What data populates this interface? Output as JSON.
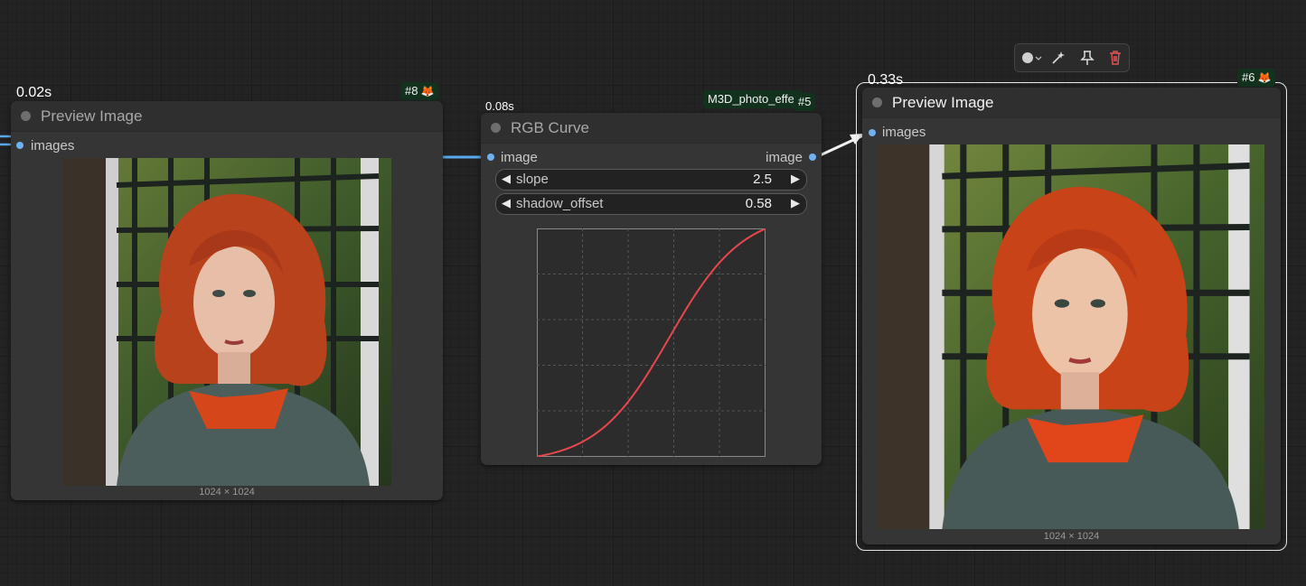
{
  "canvas": {
    "background": "#232323"
  },
  "nodes": {
    "preview_left": {
      "title": "Preview Image",
      "timer": "0.02s",
      "badge": "#8",
      "input_label": "images",
      "image_size": "1024 × 1024"
    },
    "rgb_curve": {
      "title": "RGB Curve",
      "timer": "0.08s",
      "group_badge": "M3D_photo_effe",
      "badge": "#5",
      "input_label": "image",
      "output_label": "image",
      "widgets": [
        {
          "label": "slope",
          "value": "2.5"
        },
        {
          "label": "shadow_offset",
          "value": "0.58"
        }
      ],
      "curve": {
        "color": "#e8474c",
        "slope": 2.5,
        "shadow_offset": 0.58
      }
    },
    "preview_right": {
      "title": "Preview Image",
      "timer": "0.33s",
      "badge": "#6",
      "input_label": "images",
      "image_size": "1024 × 1024",
      "selected": true
    }
  },
  "selection_toolbar": {
    "buttons": [
      {
        "icon": "color-circle-icon"
      },
      {
        "icon": "bypass-wand-icon"
      },
      {
        "icon": "pin-icon"
      },
      {
        "icon": "trash-icon"
      }
    ]
  },
  "colors": {
    "link": "#5aa9ec",
    "accent_badge": "#12321e",
    "fox": "#f08a25",
    "delete": "#e05555"
  }
}
